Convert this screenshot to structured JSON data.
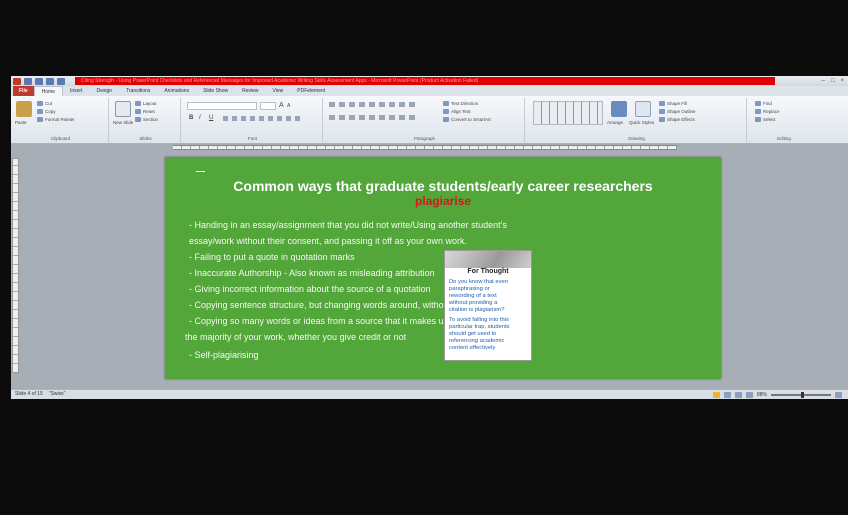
{
  "window": {
    "title": "Citing Strength - Using PowerPoint Checklists and Referenced Messages for Improved Academic Writing Skills Assessment Apps - Microsoft PowerPoint (Product Activation Failed)",
    "controls": [
      "–",
      "□",
      "×"
    ]
  },
  "ribbon": {
    "tabs": [
      {
        "label": "File",
        "kind": "file"
      },
      {
        "label": "Home",
        "kind": "active"
      },
      {
        "label": "Insert"
      },
      {
        "label": "Design"
      },
      {
        "label": "Transitions"
      },
      {
        "label": "Animations"
      },
      {
        "label": "Slide Show"
      },
      {
        "label": "Review"
      },
      {
        "label": "View"
      },
      {
        "label": "PDFelement"
      }
    ],
    "clipboard": {
      "label": "Clipboard",
      "paste": "Paste",
      "cut": "Cut",
      "copy": "Copy",
      "format_painter": "Format Painter"
    },
    "slides": {
      "label": "Slides",
      "new_slide": "New Slide",
      "layout": "Layout",
      "reset": "Reset",
      "section": "Section"
    },
    "font": {
      "label": "Font",
      "bold": "B",
      "italic": "I",
      "underline": "U",
      "size_up": "A",
      "size_down": "A"
    },
    "paragraph": {
      "label": "Paragraph",
      "text_direction": "Text Direction",
      "align_text": "Align Text",
      "smartart": "Convert to SmartArt"
    },
    "drawing": {
      "label": "Drawing",
      "arrange": "Arrange",
      "quick_styles": "Quick Styles",
      "shape_fill": "Shape Fill",
      "shape_outline": "Shape Outline",
      "shape_effects": "Shape Effects"
    },
    "editing": {
      "label": "Editing",
      "find": "Find",
      "replace": "Replace",
      "select": "Select"
    }
  },
  "slide": {
    "title_main": "Common ways that graduate students/early career researchers",
    "title_highlight": "plagiarise",
    "bullets": [
      "- Handing in an essay/assignment that you did not write/Using another student's",
      "essay/work without their consent, and passing it off as your own work.",
      "- Failing to put a quote in quotation marks",
      "- Inaccurate Authorship - Also known as misleading attribution",
      "- Giving incorrect information about the source of a quotation",
      "- Copying sentence structure, but changing words around, without givi",
      "- Copying so many words or ideas from a source that it makes up",
      "the majority of your work, whether you give credit or not",
      "- Self-plagiarising"
    ],
    "callout": {
      "title": "For Thought",
      "para1": [
        "Do you know that even",
        "paraphrasing or",
        "rewording of a text",
        "without providing a",
        "citation is plagiarism?"
      ],
      "para2": [
        "To avoid falling into this",
        "particular trap, students",
        "should get used to",
        "referencing academic",
        "content effectively"
      ]
    }
  },
  "status": {
    "slide_info": "Slide 4 of 15",
    "theme": "\"Swiss\"",
    "zoom": "88%"
  }
}
